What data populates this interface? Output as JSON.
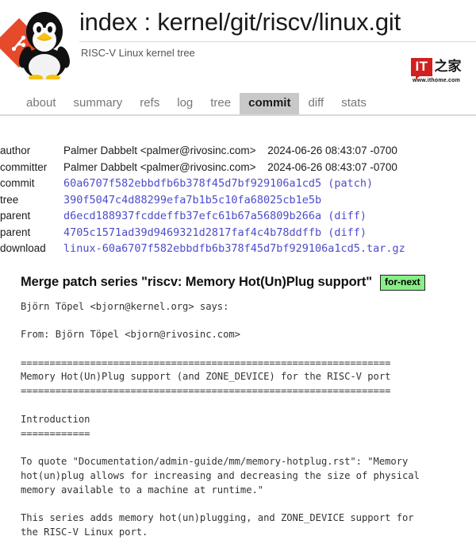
{
  "header": {
    "title": "index : kernel/git/riscv/linux.git",
    "description": "RISC-V Linux kernel tree",
    "logo_icon": "tux-penguin-git-logo",
    "watermark": {
      "brand_latin": "IT",
      "brand_cjk": "之家",
      "url": "www.ithome.com",
      "brand_color": "#d11f1f"
    }
  },
  "nav": {
    "tabs": [
      {
        "label": "about",
        "active": false
      },
      {
        "label": "summary",
        "active": false
      },
      {
        "label": "refs",
        "active": false
      },
      {
        "label": "log",
        "active": false
      },
      {
        "label": "tree",
        "active": false
      },
      {
        "label": "commit",
        "active": true
      },
      {
        "label": "diff",
        "active": false
      },
      {
        "label": "stats",
        "active": false
      }
    ],
    "active_tab_bg": "#c8c8c8"
  },
  "commit_meta": {
    "author": {
      "label": "author",
      "value": "Palmer Dabbelt <palmer@rivosinc.com>",
      "date": "2024-06-26 08:43:07 -0700"
    },
    "committer": {
      "label": "committer",
      "value": "Palmer Dabbelt <palmer@rivosinc.com>",
      "date": "2024-06-26 08:43:07 -0700"
    },
    "commit": {
      "label": "commit",
      "hash": "60a6707f582ebbdfb6b378f45d7bf929106a1cd5",
      "link": "(patch)"
    },
    "tree": {
      "label": "tree",
      "hash": "390f5047c4d88299efa7b1b5c10fa68025cb1e5b",
      "link": ""
    },
    "parent1": {
      "label": "parent",
      "hash": "d6ecd188937fcddeffb37efc61b67a56809b266a",
      "link": "(diff)"
    },
    "parent2": {
      "label": "parent",
      "hash": "4705c1571ad39d9469321d2817faf4c4b78ddffb",
      "link": "(diff)"
    },
    "download": {
      "label": "download",
      "file": "linux-60a6707f582ebbdfb6b378f45d7bf929106a1cd5.tar.gz"
    },
    "link_color": "#4c4ccc"
  },
  "commit": {
    "subject": "Merge patch series \"riscv: Memory Hot(Un)Plug support\"",
    "decoration_badge": "for-next",
    "badge_color": "#88ee88",
    "message": "Björn Töpel <bjorn@kernel.org> says:\n\nFrom: Björn Töpel <bjorn@rivosinc.com>\n\n================================================================\nMemory Hot(Un)Plug support (and ZONE_DEVICE) for the RISC-V port\n================================================================\n\nIntroduction\n============\n\nTo quote \"Documentation/admin-guide/mm/memory-hotplug.rst\": \"Memory\nhot(un)plug allows for increasing and decreasing the size of physical\nmemory available to a machine at runtime.\"\n\nThis series adds memory hot(un)plugging, and ZONE_DEVICE support for\nthe RISC-V Linux port."
  }
}
